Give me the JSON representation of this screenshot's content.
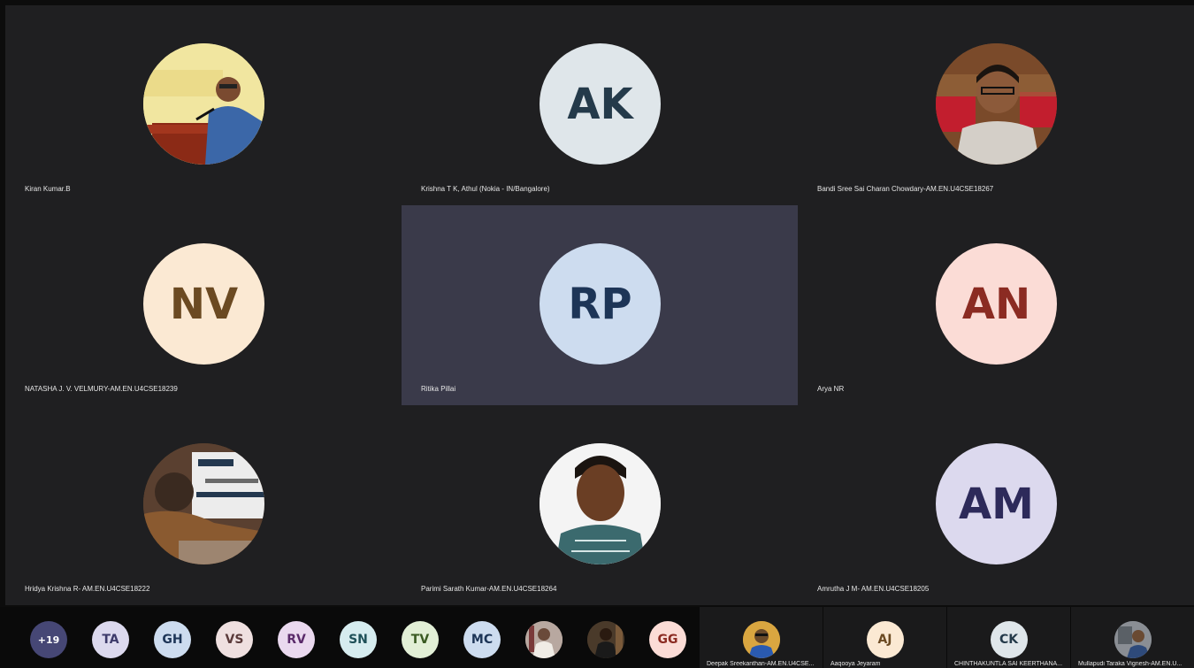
{
  "tiles": [
    {
      "name": "Kiran Kumar.B",
      "initials": "",
      "photo": "speaker-at-podium",
      "bg": "#f1e6a0",
      "fg": "#000000"
    },
    {
      "name": "Krishna T K, Athul (Nokia - IN/Bangalore)",
      "initials": "AK",
      "bg": "#dfe6ea",
      "fg": "#243a4a"
    },
    {
      "name": "Bandi Sree Sai Charan Chowdary-AM.EN.U4CSE18267",
      "initials": "",
      "photo": "man-with-glasses",
      "bg": "#8a5a3a",
      "fg": "#000000"
    },
    {
      "name": "NATASHA J. V. VELMURY-AM.EN.U4CSE18239",
      "initials": "NV",
      "bg": "#fbe9d3",
      "fg": "#6b4a22"
    },
    {
      "name": "Ritika Pillai",
      "initials": "RP",
      "bg": "#cddcef",
      "fg": "#1d3557"
    },
    {
      "name": "Arya NR",
      "initials": "AN",
      "bg": "#fbdcd6",
      "fg": "#8b2b22"
    },
    {
      "name": "Hridya Krishna R- AM.EN.U4CSE18222",
      "initials": "",
      "photo": "person-with-banner",
      "bg": "#6a4a2a",
      "fg": "#000000"
    },
    {
      "name": "Parimi Sarath Kumar-AM.EN.U4CSE18264",
      "initials": "",
      "photo": "young-man-portrait",
      "bg": "#f4f4f4",
      "fg": "#000000"
    },
    {
      "name": "Amrutha J M- AM.EN.U4CSE18205",
      "initials": "AM",
      "bg": "#dcd9ee",
      "fg": "#2d2a5a"
    }
  ],
  "active_tile_index": 4,
  "roster": [
    {
      "label": "+19",
      "bg": "#464775",
      "fg": "#ffffff",
      "kind": "overflow"
    },
    {
      "label": "TA",
      "bg": "#dcd9ee",
      "fg": "#3d3a6a"
    },
    {
      "label": "GH",
      "bg": "#cddcef",
      "fg": "#1d3557"
    },
    {
      "label": "VS",
      "bg": "#efe0e0",
      "fg": "#5a3a3a"
    },
    {
      "label": "RV",
      "bg": "#ead9ef",
      "fg": "#5a2a6a"
    },
    {
      "label": "SN",
      "bg": "#d6ecef",
      "fg": "#1e5058"
    },
    {
      "label": "TV",
      "bg": "#e2efd6",
      "fg": "#3a5a22"
    },
    {
      "label": "MC",
      "bg": "#cddcef",
      "fg": "#1d3557"
    },
    {
      "label": "",
      "photo": "roster-photo-1",
      "bg": "#b8a8a0",
      "fg": "#000000"
    },
    {
      "label": "",
      "photo": "roster-photo-2",
      "bg": "#4a3a2a",
      "fg": "#000000"
    },
    {
      "label": "GG",
      "bg": "#fbdcd6",
      "fg": "#8b2b22"
    }
  ],
  "gallery": [
    {
      "name": "Deepak Sreekanthan-AM.EN.U4CSE...",
      "initials": "",
      "photo": "gallery-photo-1",
      "bg": "#d9a640",
      "fg": "#000000"
    },
    {
      "name": "Aaqooya Jeyaram",
      "initials": "AJ",
      "bg": "#fbe9d3",
      "fg": "#6b4a22"
    },
    {
      "name": "CHINTHAKUNTLA SAI KEERTHANA...",
      "initials": "CK",
      "bg": "#dfe6ea",
      "fg": "#243a4a"
    },
    {
      "name": "Mullapudi Taraka Vignesh-AM.EN.U...",
      "initials": "",
      "photo": "gallery-photo-2",
      "bg": "#8a8e94",
      "fg": "#000000"
    }
  ]
}
